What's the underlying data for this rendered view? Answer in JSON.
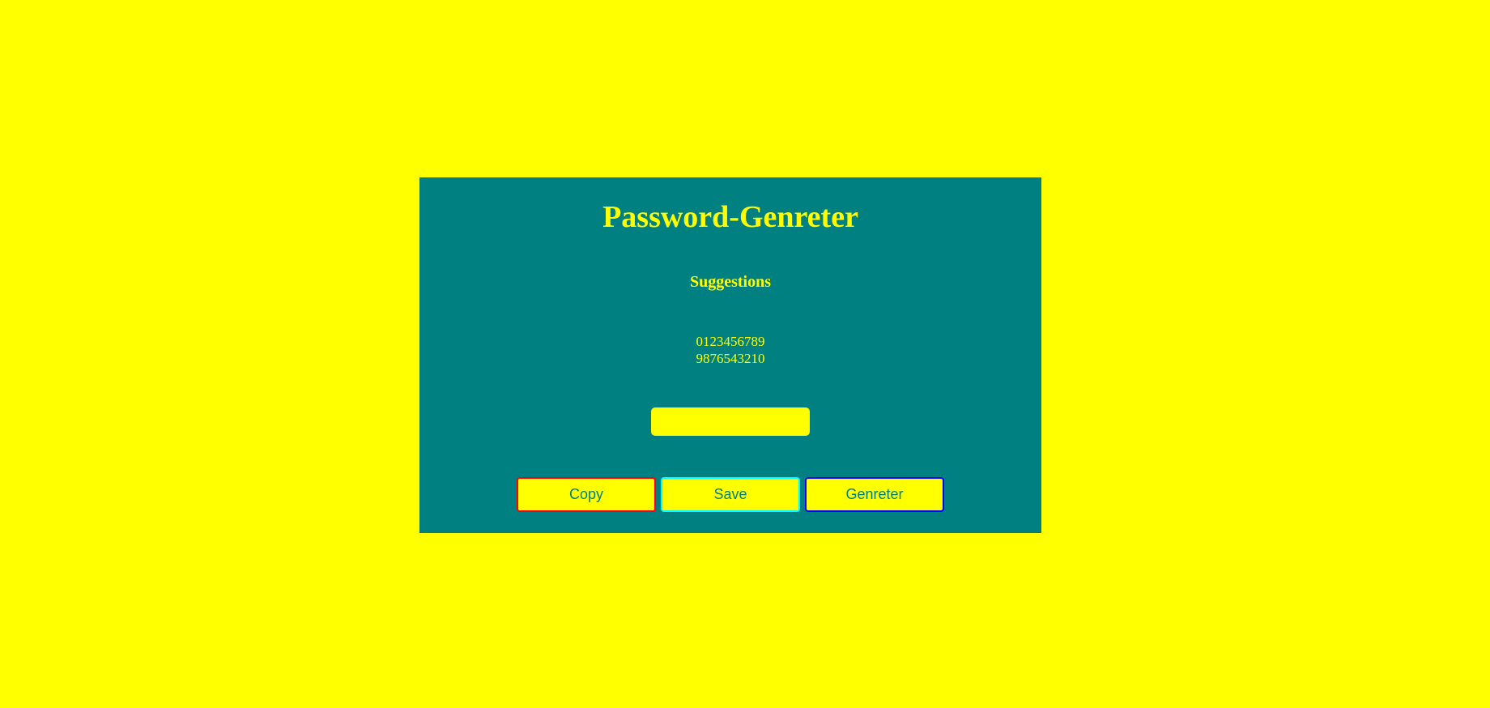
{
  "app": {
    "title": "Password-Genreter"
  },
  "suggestions": {
    "heading": "Suggestions",
    "items": [
      "0123456789",
      "9876543210"
    ]
  },
  "password_field": {
    "value": "",
    "placeholder": ""
  },
  "buttons": {
    "copy_label": "Copy",
    "save_label": "Save",
    "generate_label": "Genreter"
  },
  "colors": {
    "page_background": "#ffff00",
    "card_background": "#008080",
    "text": "#ffff00",
    "button_text": "#008080",
    "copy_border": "#ff0000",
    "save_border": "#00ffff",
    "generate_border": "#0000ff"
  }
}
